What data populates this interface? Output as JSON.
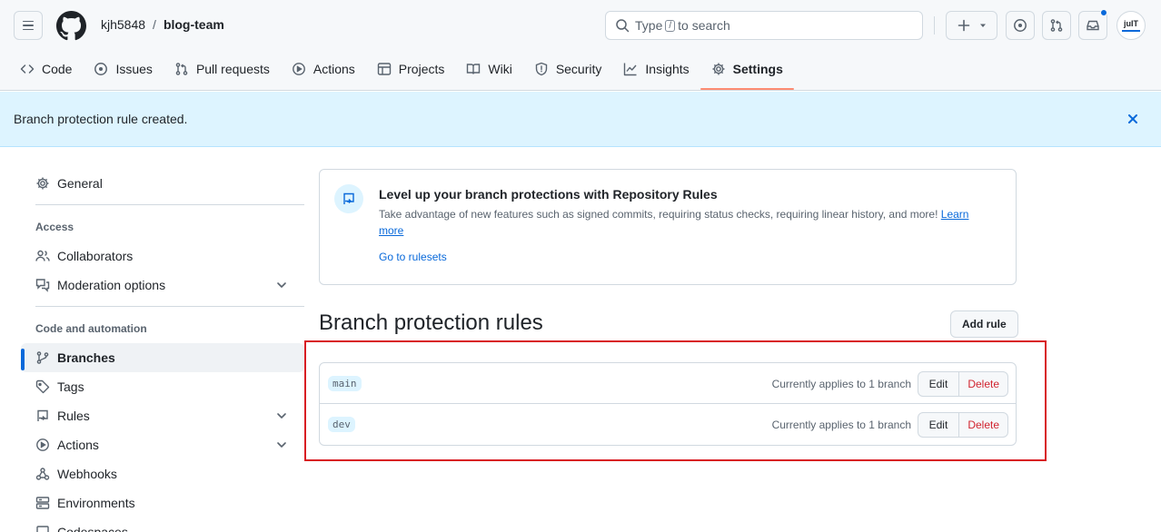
{
  "header": {
    "owner": "kjh5848",
    "separator": "/",
    "repo": "blog-team",
    "search": {
      "prefix": "Type",
      "key": "/",
      "suffix": "to search"
    },
    "avatar_text": "juIT",
    "accent_color": "#0969da"
  },
  "repo_nav": {
    "tabs": [
      {
        "label": "Code",
        "icon": "code-icon"
      },
      {
        "label": "Issues",
        "icon": "issue-opened-icon"
      },
      {
        "label": "Pull requests",
        "icon": "git-pull-request-icon"
      },
      {
        "label": "Actions",
        "icon": "play-icon"
      },
      {
        "label": "Projects",
        "icon": "table-icon"
      },
      {
        "label": "Wiki",
        "icon": "book-icon"
      },
      {
        "label": "Security",
        "icon": "shield-icon"
      },
      {
        "label": "Insights",
        "icon": "graph-icon"
      },
      {
        "label": "Settings",
        "icon": "gear-icon",
        "selected": true
      }
    ],
    "selected_underline_color": "#fd8c73"
  },
  "flash": {
    "message": "Branch protection rule created."
  },
  "sidebar": {
    "general": "General",
    "access_heading": "Access",
    "access_items": [
      "Collaborators",
      "Moderation options"
    ],
    "code_heading": "Code and automation",
    "code_items": [
      "Branches",
      "Tags",
      "Rules",
      "Actions",
      "Webhooks",
      "Environments",
      "Codespaces"
    ],
    "active_item": "Branches"
  },
  "promo": {
    "title": "Level up your branch protections with Repository Rules",
    "description": "Take advantage of new features such as signed commits, requiring status checks, requiring linear history, and more!",
    "learn_more": "Learn more",
    "link": "Go to rulesets"
  },
  "branch_protection": {
    "title": "Branch protection rules",
    "add_rule_label": "Add rule",
    "rules": [
      {
        "name": "main",
        "applies": "Currently applies to 1 branch",
        "edit": "Edit",
        "delete": "Delete"
      },
      {
        "name": "dev",
        "applies": "Currently applies to 1 branch",
        "edit": "Edit",
        "delete": "Delete"
      }
    ],
    "highlight_color": "#d81b23"
  }
}
